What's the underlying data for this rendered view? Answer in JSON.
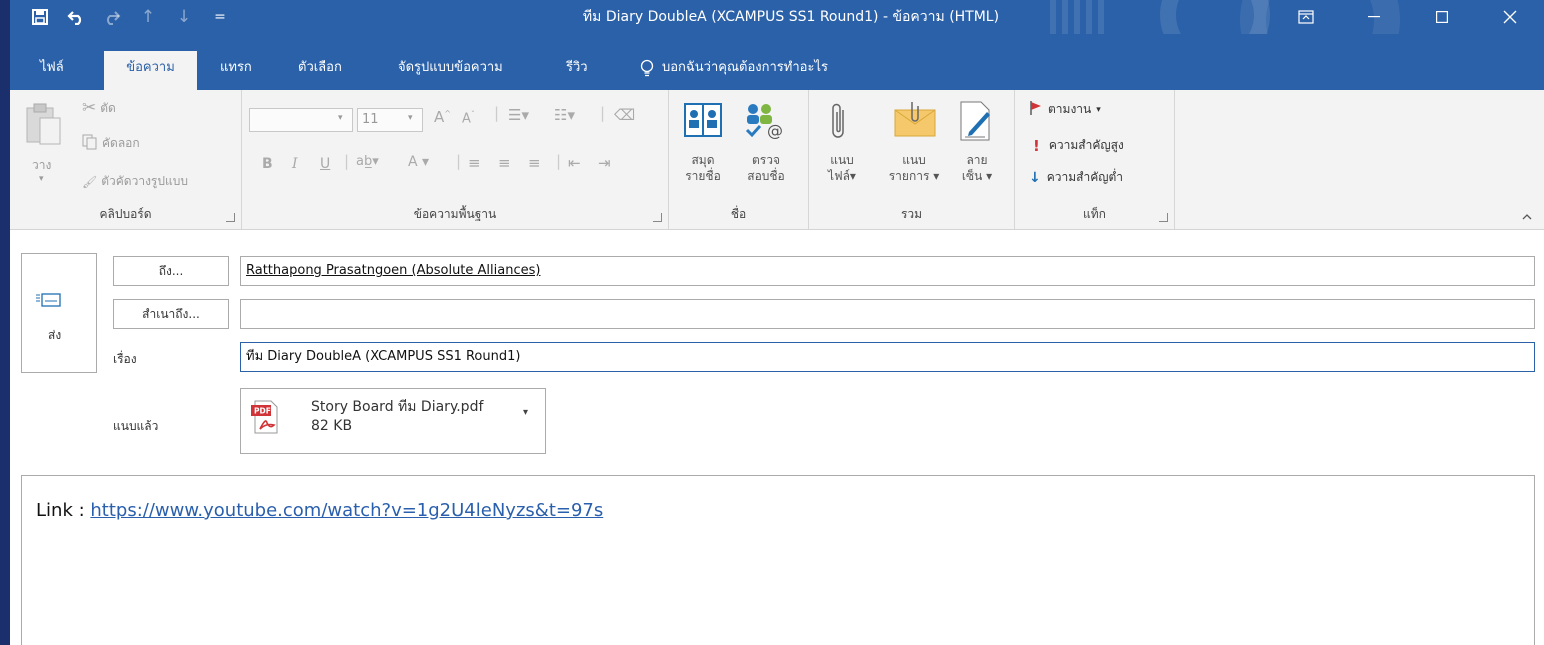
{
  "qat": {
    "save_icon": "save-icon",
    "undo_icon": "undo-icon",
    "redo_icon": "redo-icon",
    "up_icon": "arrow-up-icon",
    "down_icon": "arrow-down-icon",
    "customize_icon": "customize-qat-icon"
  },
  "window": {
    "title": "ทีม Diary DoubleA (XCAMPUS SS1 Round1)  -  ข้อความ (HTML)"
  },
  "tabs": [
    {
      "label": "ไฟล์"
    },
    {
      "label": "ข้อความ"
    },
    {
      "label": "แทรก"
    },
    {
      "label": "ตัวเลือก"
    },
    {
      "label": "จัดรูปแบบข้อความ"
    },
    {
      "label": "รีวิว"
    }
  ],
  "tellme": "บอกฉันว่าคุณต้องการทำอะไร",
  "ribbon": {
    "clipboard": {
      "paste": "วาง",
      "cut": "ตัด",
      "copy": "คัดลอก",
      "format_painter": "ตัวคัดวางรูปแบบ",
      "label": "คลิปบอร์ด"
    },
    "basic_text": {
      "font_size": "11",
      "label": "ข้อความพื้นฐาน"
    },
    "names": {
      "address_book_1": "สมุด",
      "address_book_2": "รายชื่อ",
      "check_names_1": "ตรวจ",
      "check_names_2": "สอบชื่อ",
      "label": "ชื่อ"
    },
    "include": {
      "attach_file_1": "แนบ",
      "attach_file_2": "ไฟล์",
      "attach_item_1": "แนบ",
      "attach_item_2": "รายการ",
      "signature_1": "ลาย",
      "signature_2": "เซ็น",
      "label": "รวม"
    },
    "tags": {
      "follow_up": "ตามงาน",
      "high_importance": "ความสำคัญสูง",
      "low_importance": "ความสำคัญต่ำ",
      "label": "แท็ก"
    }
  },
  "compose": {
    "send": "ส่ง",
    "to_button": "ถึง...",
    "to_value": "Ratthapong Prasatngoen (Absolute Alliances)",
    "cc_button": "สำเนาถึง...",
    "cc_value": "",
    "subject_label": "เรื่อง",
    "subject_value": "ทีม Diary DoubleA (XCAMPUS SS1 Round1)",
    "attached_label": "แนบแล้ว",
    "attachment": {
      "name": "Story Board ทีม Diary.pdf",
      "size": "82 KB",
      "badge": "PDF"
    },
    "body_prefix": "Link : ",
    "body_link": "https://www.youtube.com/watch?v=1g2U4leNyzs&t=97s"
  },
  "colors": {
    "accent": "#2b61a8",
    "link": "#2a5fad",
    "flag": "#d13438",
    "pdf": "#d13438"
  }
}
